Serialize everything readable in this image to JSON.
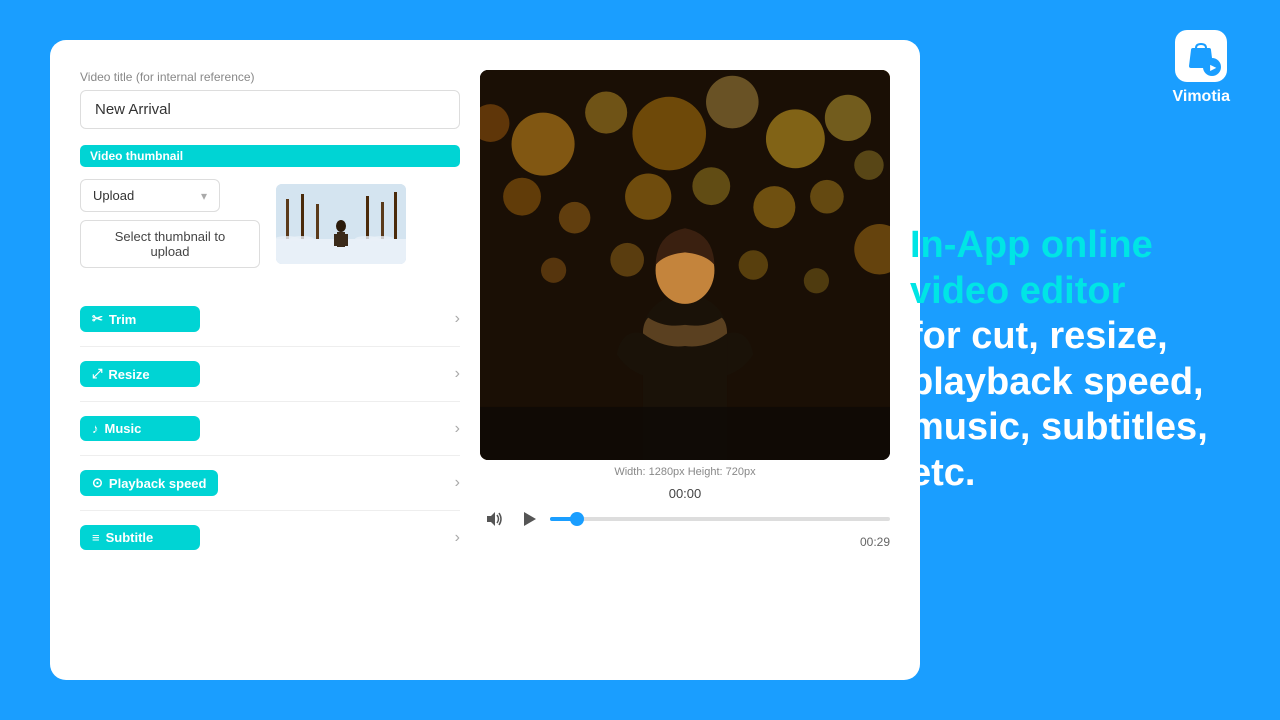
{
  "app": {
    "name": "Vimotia",
    "background_color": "#1a9eff"
  },
  "promo": {
    "headline_cyan": "In-App online video editor",
    "headline_white": "for cut, resize, playback speed, music, subtitles, etc."
  },
  "form": {
    "video_title_label": "Video title (for internal reference)",
    "video_title_value": "New Arrival",
    "video_thumbnail_badge": "Video thumbnail",
    "upload_option": "Upload",
    "select_thumbnail_btn": "Select thumbnail to upload"
  },
  "tools": [
    {
      "id": "trim",
      "label": "Trim",
      "icon": "✂"
    },
    {
      "id": "resize",
      "label": "Resize",
      "icon": "⤢"
    },
    {
      "id": "music",
      "label": "Music",
      "icon": "♪"
    },
    {
      "id": "playback-speed",
      "label": "Playback speed",
      "icon": "⊙"
    },
    {
      "id": "subtitle",
      "label": "Subtitle",
      "icon": "≡"
    }
  ],
  "video": {
    "size_label": "Width: 1280px Height: 720px",
    "current_time": "00:00",
    "duration": "00:29",
    "progress_percent": 8
  }
}
